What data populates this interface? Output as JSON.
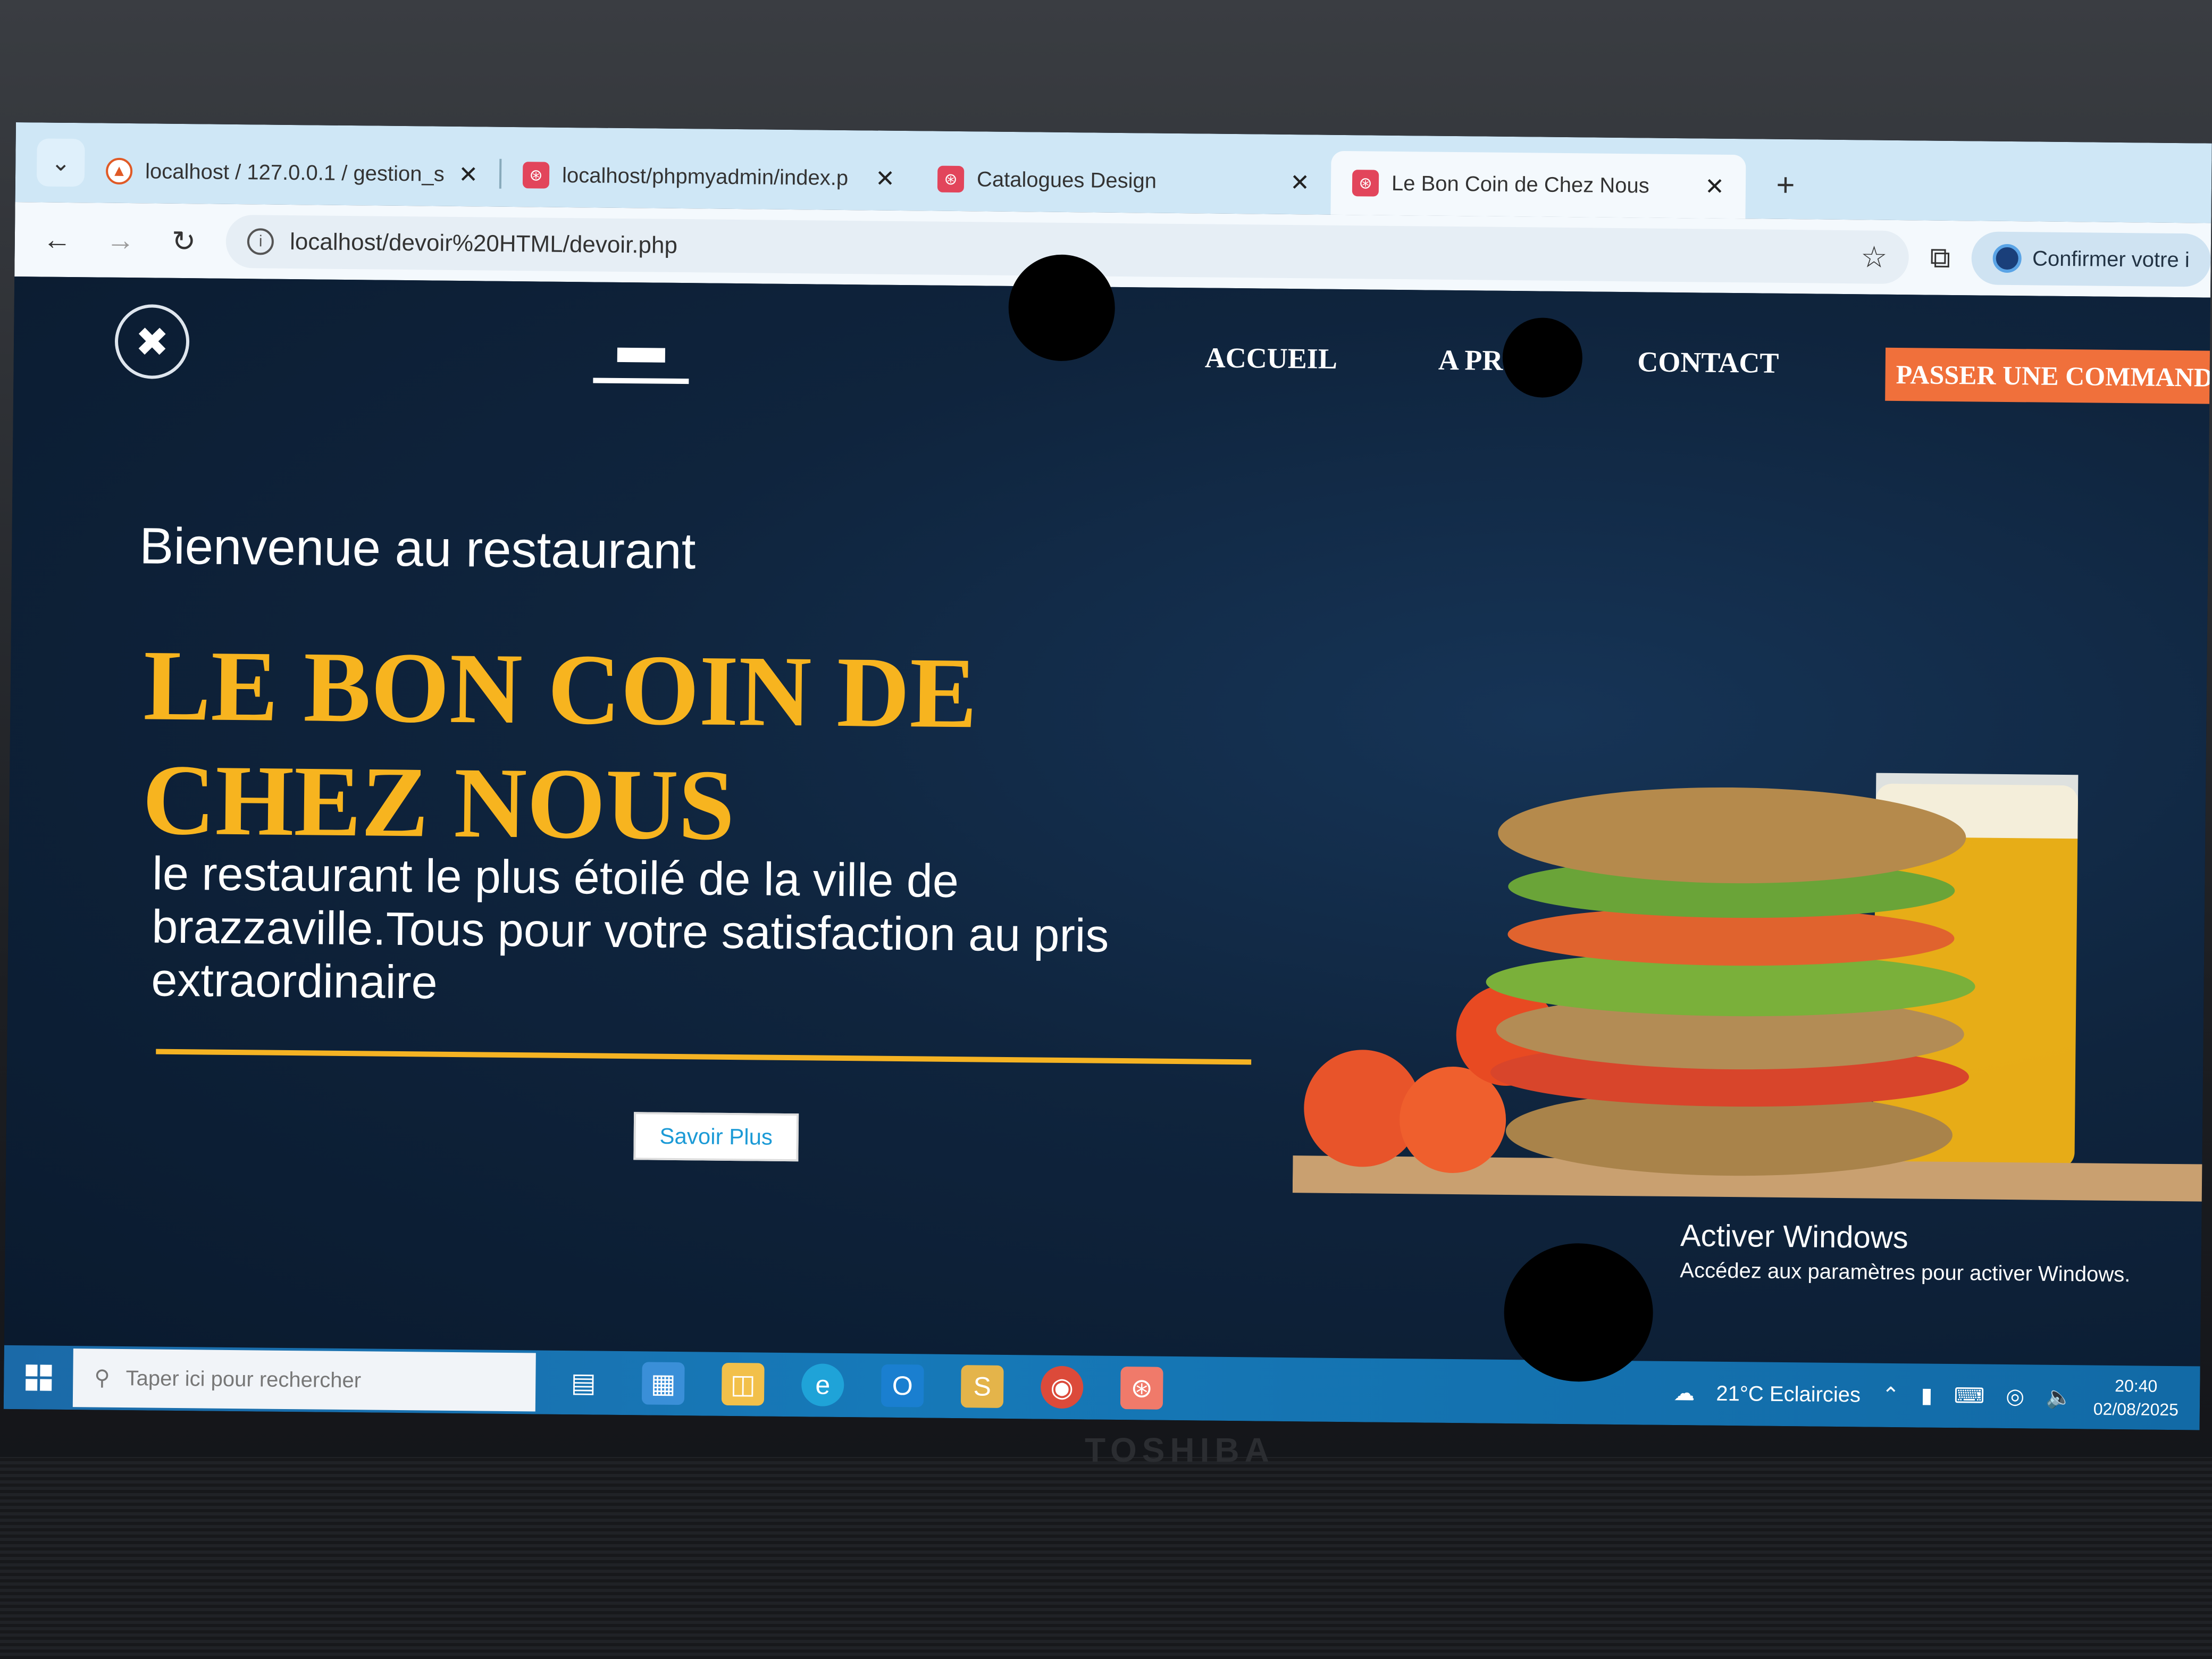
{
  "browser": {
    "tabs": [
      {
        "title": "localhost / 127.0.0.1 / gestion_s",
        "favicon": "phpmyadmin-icon",
        "active": false
      },
      {
        "title": "localhost/phpmyadmin/index.p",
        "favicon": "xampp-icon",
        "active": false
      },
      {
        "title": "Catalogues Design",
        "favicon": "xampp-icon",
        "active": false
      },
      {
        "title": "Le Bon Coin de Chez Nous",
        "favicon": "xampp-icon",
        "active": true
      }
    ],
    "address": "localhost/devoir%20HTML/devoir.php",
    "profile_button": "Confirmer votre i"
  },
  "site": {
    "nav": [
      "ACCUEIL",
      "A PROI",
      "CONTACT"
    ],
    "order_button": "PASSER UNE COMMANDE",
    "welcome": "Bienvenue au restaurant",
    "title": "LE BON COIN DE CHEZ NOUS",
    "subtitle": "le restaurant le plus étoilé de la ville de brazzaville.Tous pour votre satisfaction au pris extraordinaire",
    "more_button": "Savoir Plus",
    "accent_color": "#f7b41f"
  },
  "watermark": {
    "title": "Activer Windows",
    "text": "Accédez aux paramètres pour activer Windows."
  },
  "taskbar": {
    "search_placeholder": "Taper ici pour rechercher",
    "weather": "21°C  Eclaircies",
    "time": "20:40",
    "date": "02/08/2025"
  },
  "device": {
    "brand": "TOSHIBA"
  }
}
